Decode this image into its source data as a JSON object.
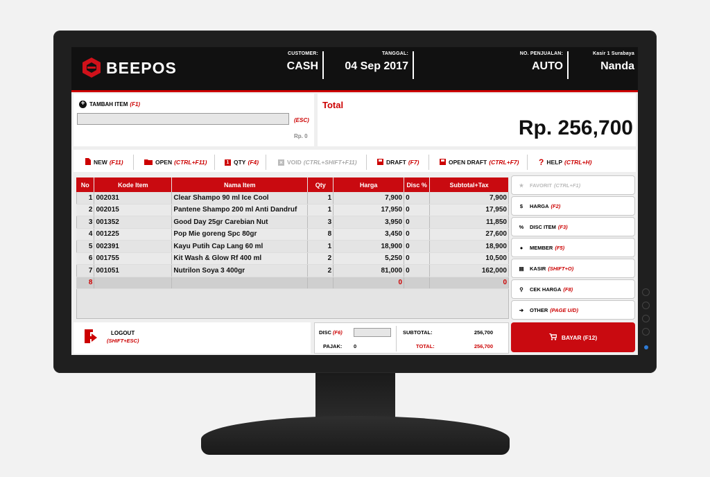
{
  "header": {
    "brand": "BEEPOS",
    "customer_label": "CUSTOMER:",
    "customer_value": "CASH",
    "date_label": "TANGGAL:",
    "date_value": "04 Sep 2017",
    "sale_no_label": "NO. PENJUALAN:",
    "sale_no_value": "AUTO",
    "cashier_label": "Kasir 1 Surabaya",
    "cashier_name": "Nanda"
  },
  "add_item": {
    "label": "TAMBAH ITEM",
    "shortcut": "(F1)",
    "input_value": "",
    "esc_hint": "(ESC)",
    "price_hint": "Rp. 0"
  },
  "total": {
    "label": "Total",
    "value": "Rp. 256,700"
  },
  "toolbar": [
    {
      "label": "NEW",
      "shortcut": "(F11)",
      "icon": "file-icon"
    },
    {
      "label": "OPEN",
      "shortcut": "(CTRL+F11)",
      "icon": "folder-icon"
    },
    {
      "label": "QTY",
      "shortcut": "(F4)",
      "icon": "qty-icon"
    },
    {
      "label": "VOID",
      "shortcut": "(CTRL+SHIFT+F11)",
      "icon": "close-icon"
    },
    {
      "label": "DRAFT",
      "shortcut": "(F7)",
      "icon": "save-icon"
    },
    {
      "label": "OPEN DRAFT",
      "shortcut": "(CTRL+F7)",
      "icon": "save-icon"
    },
    {
      "label": "HELP",
      "shortcut": "(CTRL+H)",
      "icon": "help-icon"
    }
  ],
  "table": {
    "headers": [
      "No",
      "Kode Item",
      "Nama Item",
      "Qty",
      "Harga",
      "Disc %",
      "Subtotal+Tax"
    ],
    "rows": [
      [
        "1",
        "002031",
        "Clear Shampo 90 ml Ice Cool",
        "1",
        "7,900",
        "0",
        "7,900"
      ],
      [
        "2",
        "002015",
        "Pantene Shampo 200 ml Anti Dandruf",
        "1",
        "17,950",
        "0",
        "17,950"
      ],
      [
        "3",
        "001352",
        "Good Day 25gr Carebian Nut",
        "3",
        "3,950",
        "0",
        "11,850"
      ],
      [
        "4",
        "001225",
        "Pop Mie goreng Spc 80gr",
        "8",
        "3,450",
        "0",
        "27,600"
      ],
      [
        "5",
        "002391",
        "Kayu Putih Cap Lang 60 ml",
        "1",
        "18,900",
        "0",
        "18,900"
      ],
      [
        "6",
        "001755",
        "Kit Wash & Glow Rf 400 ml",
        "2",
        "5,250",
        "0",
        "10,500"
      ],
      [
        "7",
        "001051",
        "Nutrilon Soya 3 400gr",
        "2",
        "81,000",
        "0",
        "162,000"
      ]
    ],
    "new_row": [
      "8",
      "",
      "",
      "",
      "0",
      "",
      "0"
    ]
  },
  "side_buttons": [
    {
      "label": "FAVORIT",
      "shortcut": "(CTRL+F1)",
      "icon": "star-icon"
    },
    {
      "label": "HARGA",
      "shortcut": "(F2)",
      "icon": "money-icon"
    },
    {
      "label": "DISC ITEM",
      "shortcut": "(F3)",
      "icon": "discount-icon"
    },
    {
      "label": "MEMBER",
      "shortcut": "(F5)",
      "icon": "user-icon"
    },
    {
      "label": "KASIR",
      "shortcut": "(SHIFT+O)",
      "icon": "cashier-icon"
    },
    {
      "label": "CEK HARGA",
      "shortcut": "(F8)",
      "icon": "search-icon"
    },
    {
      "label": "OTHER",
      "shortcut": "(PAGE U/D)",
      "icon": "arrow-right-icon"
    }
  ],
  "footer": {
    "logout_label": "LOGOUT",
    "logout_shortcut": "(SHIFT+ESC)",
    "disc_label": "DISC",
    "disc_shortcut": "(F6)",
    "disc_value": "",
    "pajak_label": "PAJAK:",
    "pajak_value": "0",
    "subtotal_label": "SUBTOTAL:",
    "subtotal_value": "256,700",
    "total_label": "TOTAL:",
    "total_value": "256,700",
    "pay_label": "BAYAR",
    "pay_shortcut": "(F12)"
  },
  "colors": {
    "accent": "#c90a10",
    "header_bg": "#111111"
  }
}
